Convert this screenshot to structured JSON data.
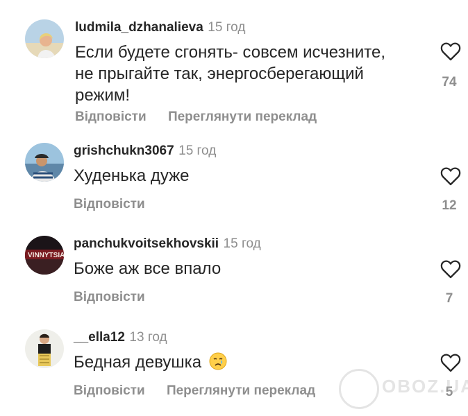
{
  "comments": [
    {
      "username": "ludmila_dzhanalieva",
      "time": "15 год",
      "text": "Если будете сгонять- совсем исчезните, не прыгайте так, энергосберегающий режим!",
      "reply": "Відповісти",
      "translate": "Переглянути переклад",
      "likes": "74"
    },
    {
      "username": "grishchukn3067",
      "time": "15 год",
      "text": "Худенька дуже",
      "reply": "Відповісти",
      "likes": "12"
    },
    {
      "username": "panchukvoitsekhovskii",
      "time": "15 год",
      "text": "Боже аж все впало",
      "reply": "Відповісти",
      "likes": "7",
      "avatar_text": "VINNYTSIA"
    },
    {
      "username": "__ella12",
      "time": "13 год",
      "text": "Бедная девушка",
      "emoji": "😢",
      "reply": "Відповісти",
      "translate": "Переглянути переклад",
      "likes": "5"
    }
  ],
  "watermark": {
    "text": "OBOZ.UA"
  },
  "colors": {
    "username": "#262626",
    "meta": "#8e8e8e",
    "text": "#262626",
    "heart_outline": "#262626"
  }
}
